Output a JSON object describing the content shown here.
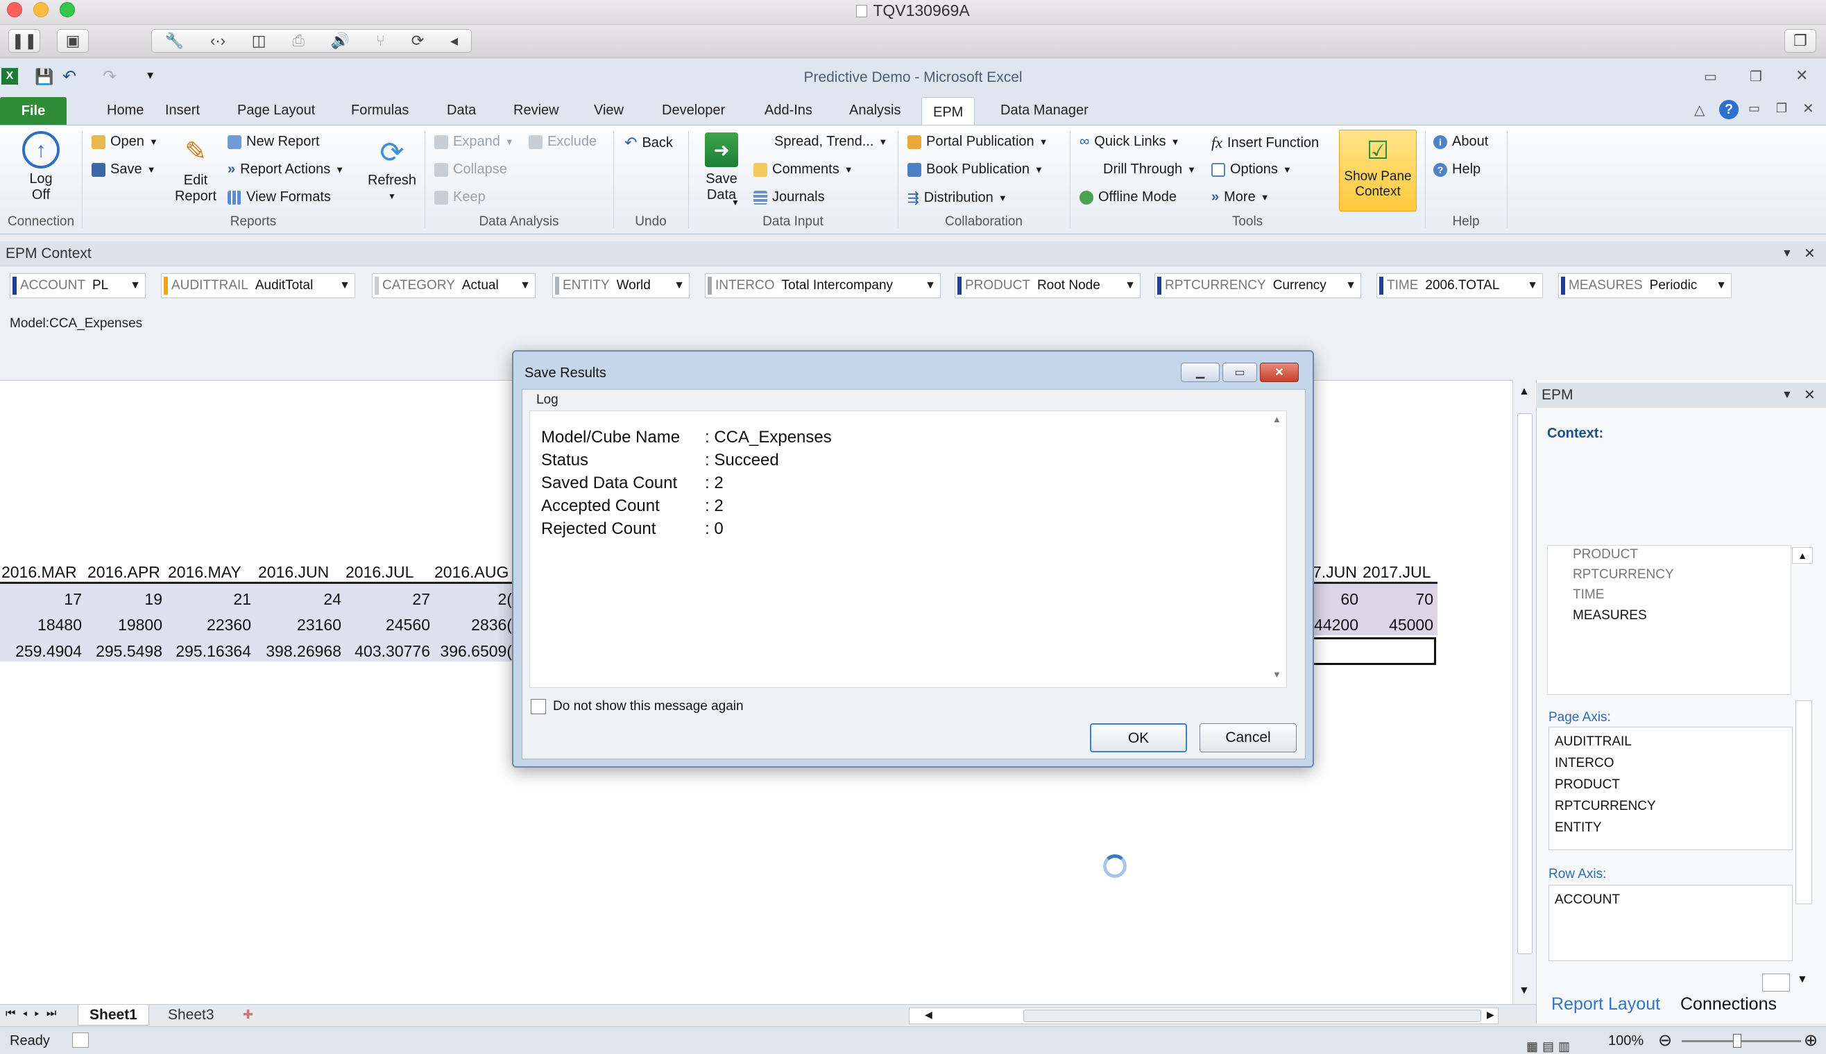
{
  "mac": {
    "title": "TQV130969A"
  },
  "excel": {
    "title": "Predictive Demo - Microsoft Excel"
  },
  "tabs": [
    "File",
    "Home",
    "Insert",
    "Page Layout",
    "Formulas",
    "Data",
    "Review",
    "View",
    "Developer",
    "Add-Ins",
    "Analysis",
    "EPM",
    "Data Manager"
  ],
  "ribbon": {
    "connection": {
      "log_off": "Log\nOff",
      "label": "Connection"
    },
    "reports": {
      "open": "Open",
      "save": "Save",
      "edit_report": "Edit\nReport",
      "new_report": "New Report",
      "report_actions": "Report Actions",
      "view_formats": "View Formats",
      "refresh": "Refresh",
      "label": "Reports"
    },
    "data_analysis": {
      "expand": "Expand",
      "exclude": "Exclude",
      "collapse": "Collapse",
      "keep": "Keep",
      "label": "Data Analysis"
    },
    "undo": {
      "back": "Back",
      "label": "Undo"
    },
    "data_input": {
      "save_data": "Save\nData",
      "spread": "Spread, Trend...",
      "comments": "Comments",
      "journals": "Journals",
      "label": "Data Input"
    },
    "collaboration": {
      "portal": "Portal Publication",
      "book": "Book Publication",
      "distribution": "Distribution",
      "label": "Collaboration"
    },
    "tools": {
      "quick_links": "Quick Links",
      "drill_through": "Drill Through",
      "offline_mode": "Offline Mode",
      "insert_function": "Insert Function",
      "options": "Options",
      "more": "More",
      "show_pane": "Show Pane\nContext",
      "label": "Tools"
    },
    "help": {
      "about": "About",
      "help": "Help",
      "label": "Help"
    }
  },
  "context": {
    "title": "EPM Context",
    "model": "Model:CCA_Expenses",
    "dims": [
      {
        "name": "ACCOUNT",
        "value": "PL",
        "color": "#1f3f8f"
      },
      {
        "name": "AUDITTRAIL",
        "value": "AuditTotal",
        "color": "#f2a516"
      },
      {
        "name": "CATEGORY",
        "value": "Actual",
        "color": "#c9cdd2"
      },
      {
        "name": "ENTITY",
        "value": "World",
        "color": "#b0b4ba"
      },
      {
        "name": "INTERCO",
        "value": "Total Intercompany",
        "color": "#a7abb1"
      },
      {
        "name": "PRODUCT",
        "value": "Root Node",
        "color": "#1f3f8f"
      },
      {
        "name": "RPTCURRENCY",
        "value": "Currency",
        "color": "#1f3f8f"
      },
      {
        "name": "TIME",
        "value": "2006.TOTAL",
        "color": "#1f3f8f"
      },
      {
        "name": "MEASURES",
        "value": "Periodic",
        "color": "#1f3f8f"
      }
    ]
  },
  "sheet": {
    "headers": [
      "2016.MAR",
      "2016.APR",
      "2016.MAY",
      "2016.JUN",
      "2016.JUL",
      "2016.AUG"
    ],
    "rows": [
      [
        "17",
        "19",
        "21",
        "24",
        "27",
        "2("
      ],
      [
        "18480",
        "19800",
        "22360",
        "23160",
        "24560",
        "2836("
      ],
      [
        "259.4904",
        "295.5498",
        "295.16364",
        "398.26968",
        "403.30776",
        "396.6509("
      ]
    ],
    "right_headers": [
      "7.JUN",
      "2017.JUL"
    ],
    "right_rows": [
      [
        "60",
        "70"
      ],
      [
        "44200",
        "45000"
      ]
    ],
    "tabs": [
      "Sheet1",
      "Sheet3"
    ]
  },
  "pane": {
    "title": "EPM",
    "context_label": "Context:",
    "context_items": [
      "PRODUCT",
      "RPTCURRENCY",
      "TIME",
      "MEASURES"
    ],
    "page_axis_label": "Page Axis:",
    "page_axis": [
      "AUDITTRAIL",
      "INTERCO",
      "PRODUCT",
      "RPTCURRENCY",
      "ENTITY"
    ],
    "row_axis_label": "Row Axis:",
    "row_axis": [
      "ACCOUNT"
    ],
    "tab_report_layout": "Report Layout",
    "tab_connections": "Connections"
  },
  "status": {
    "ready": "Ready",
    "zoom": "100%"
  },
  "dialog": {
    "title": "Save Results",
    "group": "Log",
    "lines": [
      {
        "k": "Model/Cube Name",
        "v": ": CCA_Expenses"
      },
      {
        "k": "Status",
        "v": ": Succeed"
      },
      {
        "k": "Saved Data Count",
        "v": ": 2"
      },
      {
        "k": "Accepted Count",
        "v": ": 2"
      },
      {
        "k": "Rejected Count",
        "v": ": 0"
      }
    ],
    "checkbox": "Do not show this message again",
    "ok": "OK",
    "cancel": "Cancel"
  }
}
